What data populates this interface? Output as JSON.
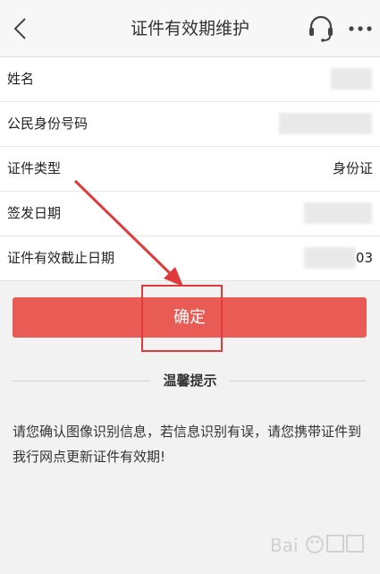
{
  "header": {
    "title": "证件有效期维护",
    "back_icon": "chevron-left-icon",
    "support_icon": "headset-icon",
    "more_icon": "more-dots-icon"
  },
  "form": {
    "rows": [
      {
        "label": "姓名",
        "value": ""
      },
      {
        "label": "公民身份号码",
        "value": ""
      },
      {
        "label": "证件类型",
        "value": "身份证"
      },
      {
        "label": "签发日期",
        "value": ""
      },
      {
        "label": "证件有效截止日期",
        "value": "03"
      }
    ]
  },
  "actions": {
    "confirm_label": "确定"
  },
  "tips": {
    "title": "温馨提示",
    "body": "请您确认图像识别信息，若信息识别有误，请您携带证件到我行网点更新证件有效期!"
  },
  "colors": {
    "primary": "#e95c56",
    "annotation": "#e03a3a",
    "background": "#f2f2f2"
  }
}
